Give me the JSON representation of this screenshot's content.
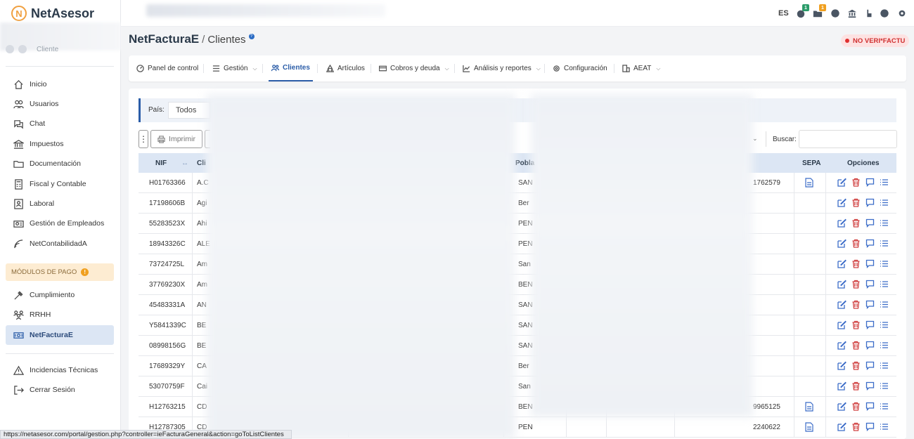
{
  "app": {
    "logo_text": "NetAsesor",
    "logo_letter": "N",
    "client_label": "Cliente"
  },
  "topbar": {
    "language": "ES",
    "badges": {
      "notifications": "1",
      "messages": "1"
    }
  },
  "sidebar": {
    "items": [
      {
        "label": "Inicio",
        "icon": "home-icon"
      },
      {
        "label": "Usuarios",
        "icon": "users-icon"
      },
      {
        "label": "Chat",
        "icon": "chat-icon"
      },
      {
        "label": "Impuestos",
        "icon": "bank-icon"
      },
      {
        "label": "Documentación",
        "icon": "folder-icon"
      },
      {
        "label": "Fiscal y Contable",
        "icon": "calculator-icon"
      },
      {
        "label": "Laboral",
        "icon": "id-card-icon"
      },
      {
        "label": "Gestión de Empleados",
        "icon": "employees-icon"
      },
      {
        "label": "NetContabilidadA",
        "icon": "signal-icon"
      }
    ],
    "paid_modules_label": "MÓDULOS DE PAGO",
    "paid_items": [
      {
        "label": "Cumplimiento",
        "icon": "gavel-icon"
      },
      {
        "label": "RRHH",
        "icon": "team-icon"
      },
      {
        "label": "NetFacturaE",
        "icon": "invoice-icon",
        "active": true
      }
    ],
    "bottom_items": [
      {
        "label": "Incidencias Técnicas",
        "icon": "warning-icon"
      },
      {
        "label": "Cerrar Sesión",
        "icon": "logout-icon"
      }
    ]
  },
  "page": {
    "app_name": "NetFacturaE",
    "separator": "/",
    "section": "Clientes",
    "help": "?",
    "verifactu_status": "NO VERI*FACTU"
  },
  "tabs": [
    {
      "label": "Panel de control",
      "dropdown": false
    },
    {
      "label": "Gestión",
      "dropdown": true
    },
    {
      "label": "Clientes",
      "dropdown": false,
      "active": true
    },
    {
      "label": "Artículos",
      "dropdown": false
    },
    {
      "label": "Cobros y deuda",
      "dropdown": true
    },
    {
      "label": "Análisis y reportes",
      "dropdown": true
    },
    {
      "label": "Configuración",
      "dropdown": false
    },
    {
      "label": "AEAT",
      "dropdown": true
    }
  ],
  "filter": {
    "country_label": "País:",
    "country_value": "Todos"
  },
  "toolbar": {
    "kebab": "⋮",
    "print_label": "Imprimir",
    "search_label": "Buscar:",
    "search_value": ""
  },
  "table": {
    "columns": {
      "nif": "NIF",
      "client": "Cli",
      "city": "Pobla",
      "sepa": "SEPA",
      "options": "Opciones"
    },
    "rows": [
      {
        "nif": "H01763366",
        "client": "A.C",
        "city": "SAN",
        "phone": "1762579",
        "sepa": true
      },
      {
        "nif": "17198606B",
        "client": "Agi",
        "city": "Ber",
        "phone": "",
        "sepa": false
      },
      {
        "nif": "55283523X",
        "client": "Ahi",
        "city": "PEÑ",
        "phone": "",
        "sepa": false
      },
      {
        "nif": "18943326C",
        "client": "ALE",
        "city": "PEÑ",
        "phone": "",
        "sepa": false
      },
      {
        "nif": "73724725L",
        "client": "Am",
        "city": "San",
        "phone": "",
        "sepa": false
      },
      {
        "nif": "37769230X",
        "client": "Am",
        "city": "BEN",
        "phone": "",
        "sepa": false
      },
      {
        "nif": "45483331A",
        "client": "AN",
        "city": "SAN",
        "phone": "",
        "sepa": false
      },
      {
        "nif": "Y5841339C",
        "client": "BE",
        "city": "SAN",
        "phone": "",
        "sepa": false
      },
      {
        "nif": "08998156G",
        "client": "BE",
        "city": "SAN",
        "phone": "",
        "sepa": false
      },
      {
        "nif": "17689329Y",
        "client": "CA",
        "city": "Ber",
        "phone": "",
        "sepa": false
      },
      {
        "nif": "53070759F",
        "client": "Cai",
        "city": "San",
        "phone": "",
        "sepa": false
      },
      {
        "nif": "H12763215",
        "client": "CD",
        "city": "BEN",
        "phone": "9965125",
        "sepa": true
      },
      {
        "nif": "H12787305",
        "client": "CD",
        "city": "PEÑ",
        "phone": "2240622",
        "sepa": true
      }
    ]
  },
  "statusbar": {
    "url": "https://netasesor.com/portal/gestion.php?controller=ieFacturaGeneral&action=goToListClientes"
  },
  "colors": {
    "primary": "#2b5da8",
    "active_bg": "#dce6f4",
    "danger": "#d04040",
    "warning": "#f0a020"
  }
}
